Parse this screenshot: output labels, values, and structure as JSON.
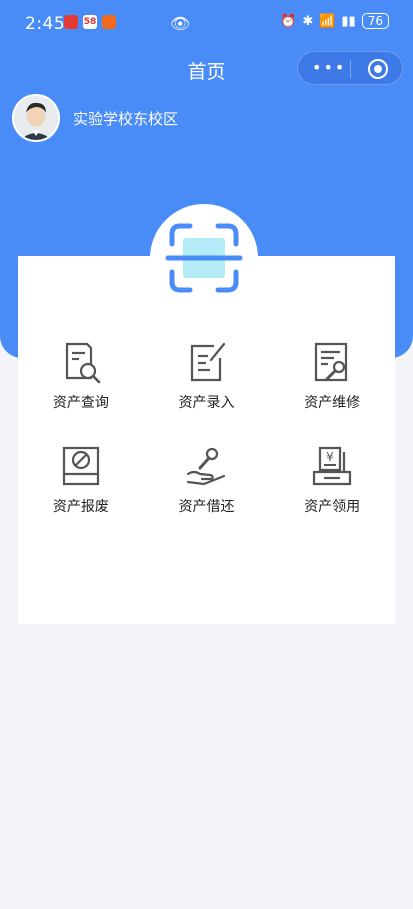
{
  "status_bar": {
    "time": "2:45",
    "notification_badge": "58",
    "battery": "76"
  },
  "header": {
    "title": "首页",
    "more_icon": "more-dots-icon",
    "close_icon": "target-icon"
  },
  "user": {
    "school_name": "实验学校东校区"
  },
  "colors": {
    "primary_blue": "#4a8cf7",
    "scan_light_blue": "#b3ecf7",
    "icon_gray": "#555555"
  },
  "menu": [
    {
      "label": "资产查询",
      "icon": "asset-search-icon"
    },
    {
      "label": "资产录入",
      "icon": "asset-entry-icon"
    },
    {
      "label": "资产维修",
      "icon": "asset-repair-icon"
    },
    {
      "label": "资产报废",
      "icon": "asset-scrap-icon"
    },
    {
      "label": "资产借还",
      "icon": "asset-borrow-icon"
    },
    {
      "label": "资产领用",
      "icon": "asset-receive-icon"
    }
  ]
}
